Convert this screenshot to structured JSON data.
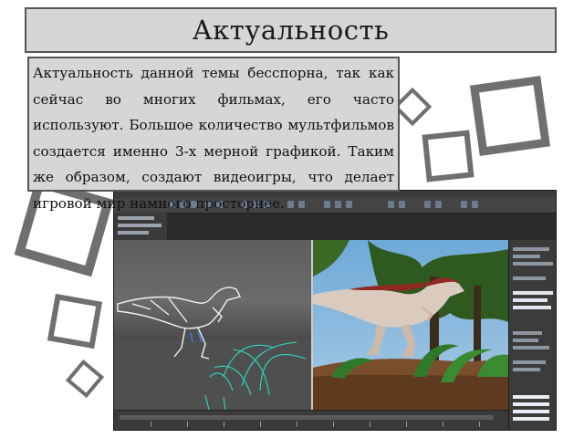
{
  "slide": {
    "title": "Актуальность",
    "body": "Актуальность данной темы бесспорна, так как сейчас во многих фильмах, его часто используют. Большое количество мультфильмов создается именно 3-х мерной графикой. Таким же образом, создают видеоигры, что делает игровой мир намного просторнее."
  },
  "colors": {
    "box_fill": "#d6d6d6",
    "box_border": "#555555",
    "decor_square": "#6f6f6f"
  },
  "image": {
    "content": "screenshot of 3D modeling software with wireframe dinosaur and rendered dinosaur viewports"
  }
}
